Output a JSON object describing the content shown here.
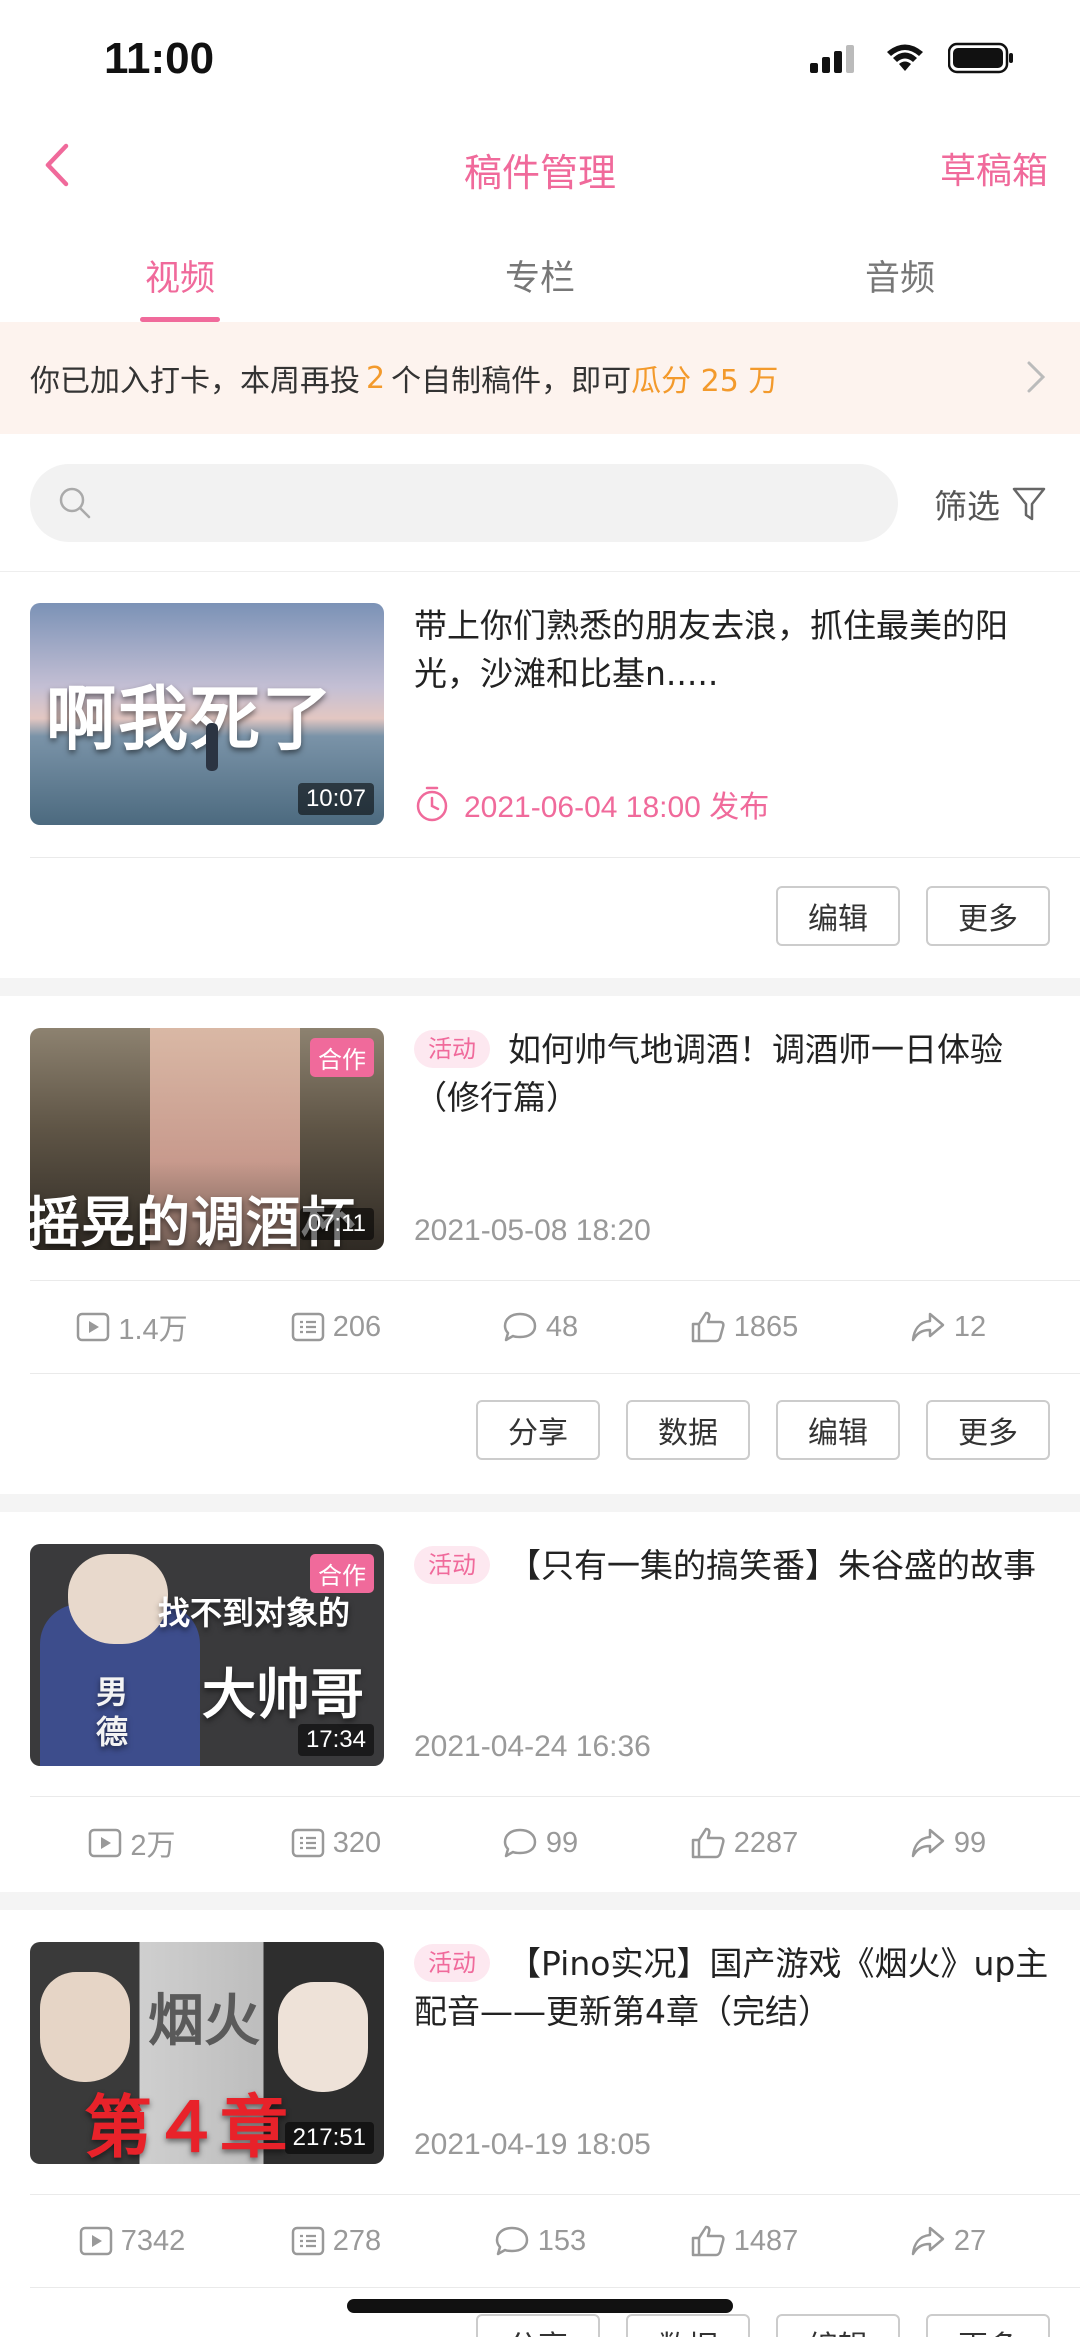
{
  "status": {
    "time": "11:00"
  },
  "nav": {
    "title": "稿件管理",
    "drafts": "草稿箱"
  },
  "tabs": [
    {
      "label": "视频",
      "active": true
    },
    {
      "label": "专栏",
      "active": false
    },
    {
      "label": "音频",
      "active": false
    }
  ],
  "banner": {
    "text_1": "你已加入打卡，本周再投",
    "count": "2",
    "text_2": "个自制稿件，即可",
    "reward": "瓜分 25 万"
  },
  "search": {
    "placeholder": "",
    "filter_label": "筛选"
  },
  "colors": {
    "accent": "#f06a9b",
    "highlight": "#f39a2c",
    "banner_bg": "#fdf3ee"
  },
  "videos": [
    {
      "title": "带上你们熟悉的朋友去浪，抓住最美的阳光，沙滩和比基n.....",
      "thumb_text": "啊我死了",
      "duration": "10:07",
      "scheduled": "2021-06-04 18:00 发布",
      "actions": [
        "编辑",
        "更多"
      ]
    },
    {
      "tag": "活动",
      "title": "如何帅气地调酒！调酒师一日体验（修行篇）",
      "thumb_text": "摇晃的调酒杯",
      "coop": "合作",
      "duration": "07:11",
      "time": "2021-05-08 18:20",
      "stats": {
        "views": "1.4万",
        "danmaku": "206",
        "comments": "48",
        "likes": "1865",
        "shares": "12"
      },
      "actions": [
        "分享",
        "数据",
        "编辑",
        "更多"
      ]
    },
    {
      "tag": "活动",
      "title": "【只有一集的搞笑番】朱谷盛的故事",
      "thumb_text_1": "找不到对象的",
      "thumb_text_2": "大帅哥",
      "thumb_text_3": "男德",
      "coop": "合作",
      "duration": "17:34",
      "time": "2021-04-24 16:36",
      "stats": {
        "views": "2万",
        "danmaku": "320",
        "comments": "99",
        "likes": "2287",
        "shares": "99"
      }
    },
    {
      "tag": "活动",
      "title": "【Pino实况】国产游戏《烟火》up主配音——更新第4章（完结）",
      "thumb_text_1": "烟火",
      "thumb_text_2": "第４章",
      "duration": "217:51",
      "time": "2021-04-19 18:05",
      "stats": {
        "views": "7342",
        "danmaku": "278",
        "comments": "153",
        "likes": "1487",
        "shares": "27"
      },
      "actions": [
        "分享",
        "数据",
        "编辑",
        "更多"
      ]
    }
  ]
}
